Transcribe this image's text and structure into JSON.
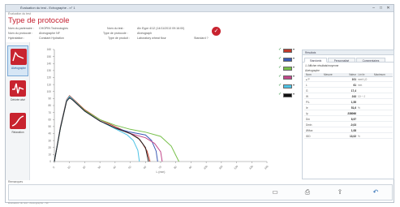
{
  "window": {
    "title": "Évaluation du test - Echographe - n° 1",
    "subtitle": "Évaluation du test"
  },
  "page": {
    "title": "Type de protocole",
    "info": {
      "partner_label": "Nom du partenaire :",
      "partner_value": "CHOPIN Technologies",
      "protocol_name_label": "Nom du protocole :",
      "protocol_name_value": "Alvéographe NF",
      "hydration_label": "Hydratation :",
      "hydration_value": "Constant Hydration",
      "test_name_label": "Nom du test :",
      "test_name_value": "Alv Eype 4/12 (14/11/2013 09:16:00)",
      "protocol_type_label": "Type de protocole :",
      "protocol_type_value": "Alvéograph",
      "product_type_label": "Type de produit :",
      "product_type_value": "Laboratory wheat flour",
      "standard_label": "Standard ?",
      "standard_icon": "check-icon"
    }
  },
  "nav": [
    {
      "label": "Alvéographe",
      "icon": "alveograph-icon",
      "active": true
    },
    {
      "label": "Dérivée alvé",
      "icon": "derivative-icon",
      "active": false
    },
    {
      "label": "Relaxation",
      "icon": "relaxation-icon",
      "active": false
    }
  ],
  "chart_data": {
    "type": "line",
    "x_ticks": [
      "0",
      "10",
      "20",
      "30",
      "40",
      "50",
      "60",
      "70",
      "80",
      "90",
      "100",
      "110",
      "120",
      "130",
      "140"
    ],
    "y_ticks": [
      "0",
      "10",
      "20",
      "30",
      "40",
      "50",
      "60",
      "70",
      "80",
      "90",
      "100",
      "110",
      "120",
      "130",
      "140",
      "150",
      "160"
    ],
    "xlim": [
      0,
      140
    ],
    "ylim": [
      0,
      160
    ],
    "xlabel": "L (mm)",
    "grid": false,
    "series": [
      {
        "color": "#c0392b",
        "x": [
          0,
          4,
          8,
          10,
          12,
          20,
          30,
          40,
          50,
          55,
          58,
          61,
          63
        ],
        "y": [
          0,
          50,
          88,
          94,
          90,
          74,
          60,
          50,
          40,
          34,
          26,
          15,
          0
        ]
      },
      {
        "color": "#3b5bb5",
        "x": [
          0,
          4,
          8,
          10,
          12,
          20,
          30,
          40,
          50,
          60,
          64,
          67,
          68
        ],
        "y": [
          0,
          48,
          86,
          92,
          88,
          72,
          58,
          48,
          42,
          38,
          30,
          15,
          0
        ]
      },
      {
        "color": "#77c04a",
        "x": [
          0,
          4,
          8,
          10,
          12,
          20,
          30,
          40,
          50,
          60,
          70,
          77,
          82
        ],
        "y": [
          0,
          48,
          86,
          93,
          89,
          73,
          60,
          52,
          46,
          42,
          36,
          22,
          0
        ]
      },
      {
        "color": "#c2478a",
        "x": [
          0,
          4,
          8,
          10,
          12,
          20,
          30,
          40,
          50,
          60,
          66,
          70,
          71
        ],
        "y": [
          0,
          49,
          86,
          92,
          88,
          72,
          58,
          48,
          40,
          34,
          26,
          14,
          0
        ]
      },
      {
        "color": "#4fc3e6",
        "x": [
          0,
          4,
          8,
          10,
          12,
          20,
          30,
          40,
          48,
          52,
          55,
          56
        ],
        "y": [
          0,
          49,
          87,
          93,
          89,
          72,
          58,
          47,
          38,
          30,
          16,
          0
        ]
      },
      {
        "color": "#222222",
        "x": [
          0,
          4,
          8,
          10,
          12,
          20,
          30,
          40,
          50,
          56,
          60,
          62
        ],
        "y": [
          0,
          48,
          86,
          91,
          88,
          72,
          58,
          48,
          40,
          32,
          20,
          0
        ]
      }
    ]
  },
  "legend": [
    {
      "color": "#c0392b"
    },
    {
      "color": "#3b5bb5"
    },
    {
      "color": "#77c04a"
    },
    {
      "color": "#c2478a"
    },
    {
      "color": "#4fc3e6"
    },
    {
      "color": "#111111"
    }
  ],
  "panel": {
    "title": "Résultats",
    "tabs": [
      "Standards",
      "Personnalisé",
      "Commentaires"
    ],
    "show_results_label": "Afficher résultats/moyenne",
    "section": "Alvéographe",
    "columns": [
      "Nom",
      "Mesure",
      "Valeur",
      "Limite",
      "Maximum"
    ],
    "rows": [
      {
        "name": "▸ P",
        "value": "101",
        "unit": "mmH₂O"
      },
      {
        "name": "L",
        "value": "61",
        "unit": "mm"
      },
      {
        "name": "G",
        "value": "17,4",
        "unit": ""
      },
      {
        "name": "W",
        "value": "243",
        "unit": "10⁻⁴ J"
      },
      {
        "name": "P/L",
        "value": "1,55",
        "unit": ""
      },
      {
        "name": "Ie",
        "value": "51,6",
        "unit": "%"
      },
      {
        "name": "Ip",
        "value": "238066",
        "unit": ""
      },
      {
        "name": "Dm",
        "value": "8,97",
        "unit": ""
      },
      {
        "name": "Dmin",
        "value": "-0,03",
        "unit": ""
      },
      {
        "name": "ØMax",
        "value": "1,08",
        "unit": ""
      },
      {
        "name": "IDD",
        "value": "13,02",
        "unit": "%"
      }
    ]
  },
  "notes": {
    "label": "Remarques"
  },
  "bottom_buttons": [
    {
      "icon": "save-icon"
    },
    {
      "icon": "print-icon"
    },
    {
      "icon": "export-icon"
    },
    {
      "icon": "undo-icon"
    }
  ],
  "bottom_text": "Évaluation du test - Alvéographe - NF"
}
